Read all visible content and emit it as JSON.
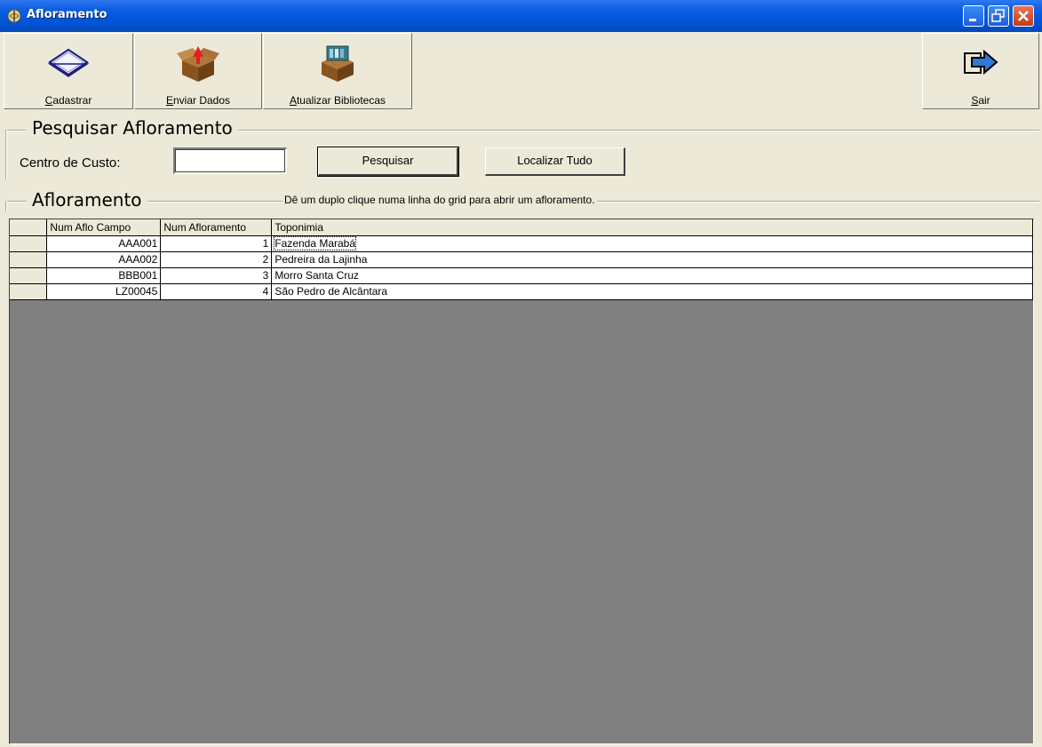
{
  "window": {
    "title": "Afloramento",
    "controls": [
      "minimize",
      "restore",
      "close"
    ]
  },
  "toolbar": {
    "buttons": [
      {
        "label_prefix": "",
        "accel": "C",
        "label_rest": "adastrar",
        "icon": "diamond-paper-icon"
      },
      {
        "label_prefix": "",
        "accel": "E",
        "label_rest": "nviar Dados",
        "icon": "box-upload-icon"
      },
      {
        "label_prefix": "",
        "accel": "A",
        "label_rest": "tualizar Bibliotecas",
        "icon": "box-library-icon"
      },
      {
        "label_prefix": "",
        "accel": "S",
        "label_rest": "air",
        "icon": "exit-arrow-icon"
      }
    ]
  },
  "search_group": {
    "title": "Pesquisar Afloramento",
    "cost_center_label": "Centro de Custo:",
    "cost_center_value": "",
    "search_button": "Pesquisar",
    "find_all_button": "Localizar Tudo"
  },
  "grid_group": {
    "title": "Afloramento",
    "hint": "Dê um duplo clique numa linha do grid para abrir um afloramento."
  },
  "grid": {
    "columns": [
      "Num Aflo Campo",
      "Num Afloramento",
      "Toponimia"
    ],
    "rows": [
      {
        "campo": "AAA001",
        "num": "1",
        "toponimia": "Fazenda Marabá"
      },
      {
        "campo": "AAA002",
        "num": "2",
        "toponimia": "Pedreira da Lajinha"
      },
      {
        "campo": "BBB001",
        "num": "3",
        "toponimia": "Morro Santa Cruz"
      },
      {
        "campo": "LZ00045",
        "num": "4",
        "toponimia": "São Pedro de Alcântara"
      }
    ]
  },
  "colors": {
    "titlebar": "#0054d8",
    "face": "#ece9d8",
    "grid_empty": "#808080"
  }
}
